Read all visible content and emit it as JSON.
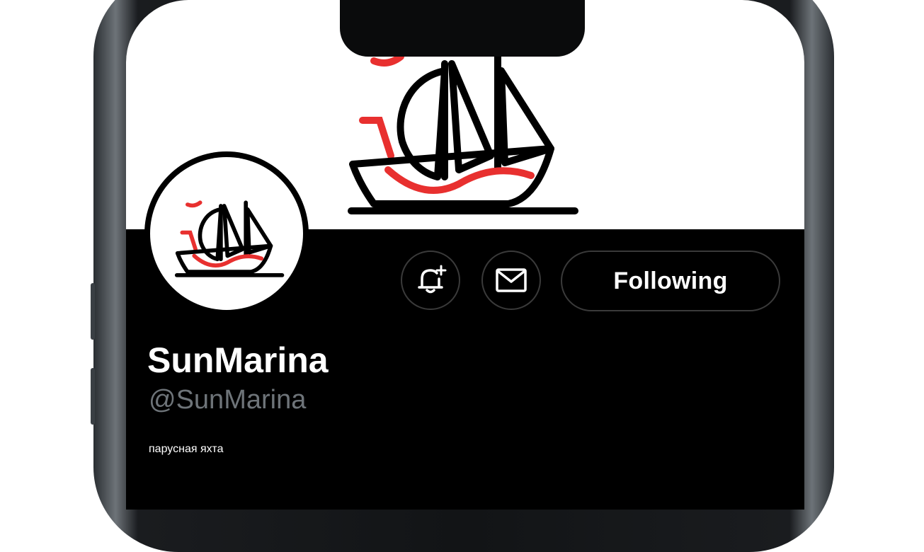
{
  "profile": {
    "display_name": "SunMarina",
    "handle": "@SunMarina",
    "bio": "парусная яхта"
  },
  "actions": {
    "notify_icon": "bell-plus-icon",
    "message_icon": "envelope-icon",
    "follow_label": "Following"
  },
  "colors": {
    "accent_red": "#e8302f",
    "background": "#000000",
    "text_primary": "#ffffff",
    "text_secondary": "#6e7479"
  }
}
